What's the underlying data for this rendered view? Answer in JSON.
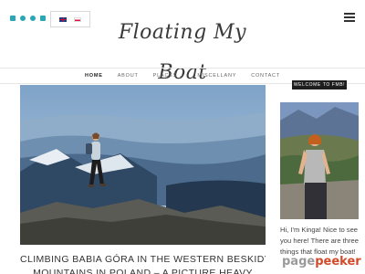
{
  "site": {
    "logo_text": "Floating My Boat"
  },
  "social": {
    "icons": [
      "facebook-icon",
      "flickr-icon",
      "pinterest-icon",
      "instagram-icon"
    ],
    "color": "#2ba6b6"
  },
  "language": {
    "options": [
      "English",
      "Polski"
    ]
  },
  "nav": {
    "items": [
      {
        "label": "HOME"
      },
      {
        "label": "ABOUT"
      },
      {
        "label": "PLACES"
      },
      {
        "label": "MISCELLANY"
      },
      {
        "label": "CONTACT"
      }
    ]
  },
  "post": {
    "title_line1": "CLIMBING BABIA GÓRA IN THE WESTERN BESKIDY",
    "title_line2": "MOUNTAINS IN POLAND – A PICTURE HEAVY"
  },
  "sidebar": {
    "badge": "WELCOME TO FMB!",
    "intro_text": "Hi, I'm Kinga! Nice to see you here! There are three things that float my boat!"
  },
  "watermark": {
    "part1": "page",
    "part2": "peeker"
  },
  "colors": {
    "accent": "#2ba6b6",
    "badge_bg": "#1e1e1e",
    "watermark_red": "#d34a2a"
  }
}
